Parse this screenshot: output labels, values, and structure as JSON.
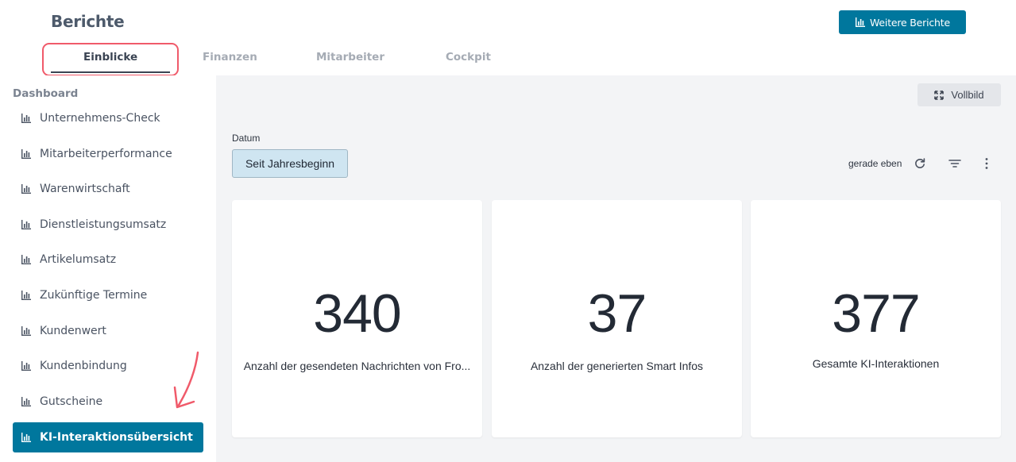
{
  "header": {
    "title": "Berichte",
    "more_reports_label": "Weitere Berichte"
  },
  "tabs": [
    {
      "label": "Einblicke",
      "active": true
    },
    {
      "label": "Finanzen",
      "active": false
    },
    {
      "label": "Mitarbeiter",
      "active": false
    },
    {
      "label": "Cockpit",
      "active": false
    }
  ],
  "sidebar": {
    "heading": "Dashboard",
    "items": [
      {
        "label": "Unternehmens-Check",
        "icon": "bar-chart-icon"
      },
      {
        "label": "Mitarbeiterperformance",
        "icon": "bar-chart-icon"
      },
      {
        "label": "Warenwirtschaft",
        "icon": "bar-chart-icon"
      },
      {
        "label": "Dienstleistungsumsatz",
        "icon": "bar-chart-icon"
      },
      {
        "label": "Artikelumsatz",
        "icon": "bar-chart-icon"
      },
      {
        "label": "Zukünftige Termine",
        "icon": "bar-chart-icon"
      },
      {
        "label": "Kundenwert",
        "icon": "bar-chart-icon"
      },
      {
        "label": "Kundenbindung",
        "icon": "bar-chart-icon"
      },
      {
        "label": "Gutscheine",
        "icon": "bar-chart-icon"
      },
      {
        "label": "KI-Interaktionsübersicht",
        "icon": "bar-chart-icon",
        "active": true
      }
    ]
  },
  "main": {
    "fullscreen_label": "Vollbild",
    "date_label": "Datum",
    "date_value": "Seit Jahresbeginn",
    "updated_text": "gerade eben",
    "cards": [
      {
        "value": "340",
        "label": "Anzahl der gesendeten Nachrichten von Fro..."
      },
      {
        "value": "37",
        "label": "Anzahl der generierten Smart Infos"
      },
      {
        "value": "377",
        "label": "Gesamte KI-Interaktionen"
      }
    ]
  },
  "colors": {
    "accent": "#00779d",
    "annotation": "#f05a6a",
    "main_background": "#f3f4f6"
  }
}
